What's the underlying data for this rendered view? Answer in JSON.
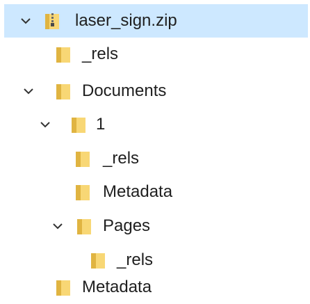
{
  "tree": {
    "root": {
      "label": "laser_sign.zip",
      "icon": "zip-folder-icon",
      "expanded": true,
      "selected": true
    },
    "items": [
      {
        "label": "_rels",
        "icon": "folder-icon"
      },
      {
        "label": "Documents",
        "icon": "folder-icon",
        "expanded": true
      },
      {
        "label": "1",
        "icon": "folder-icon",
        "expanded": true
      },
      {
        "label": "_rels",
        "icon": "folder-icon"
      },
      {
        "label": "Metadata",
        "icon": "folder-icon"
      },
      {
        "label": "Pages",
        "icon": "folder-icon",
        "expanded": true
      },
      {
        "label": "_rels",
        "icon": "folder-icon"
      },
      {
        "label": "Metadata",
        "icon": "folder-icon"
      }
    ]
  },
  "colors": {
    "selection": "#cde8ff",
    "folder_light": "#f8d775",
    "folder_dark": "#e0b441",
    "chevron": "#333333"
  }
}
